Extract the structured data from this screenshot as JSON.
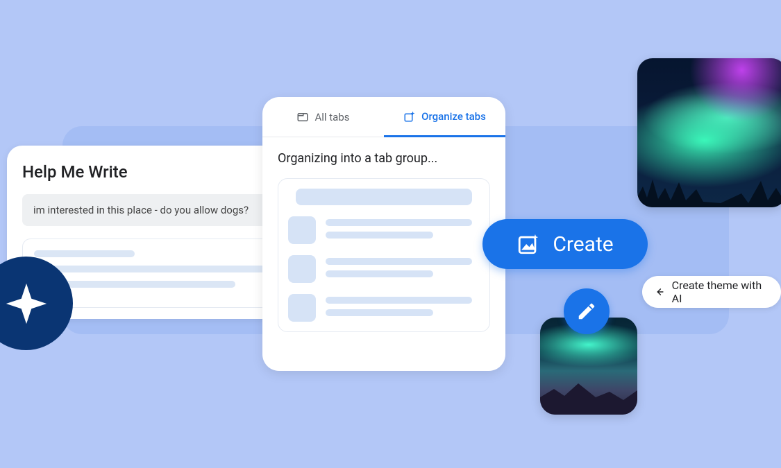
{
  "help_me_write": {
    "title": "Help Me Write",
    "input_text": "im interested in this place - do you allow dogs?"
  },
  "tab_organizer": {
    "tab_all_label": "All tabs",
    "tab_organize_label": "Organize tabs",
    "status_text": "Organizing into a tab group..."
  },
  "create_button": {
    "label": "Create"
  },
  "theme_chip": {
    "label": "Create theme with AI"
  }
}
